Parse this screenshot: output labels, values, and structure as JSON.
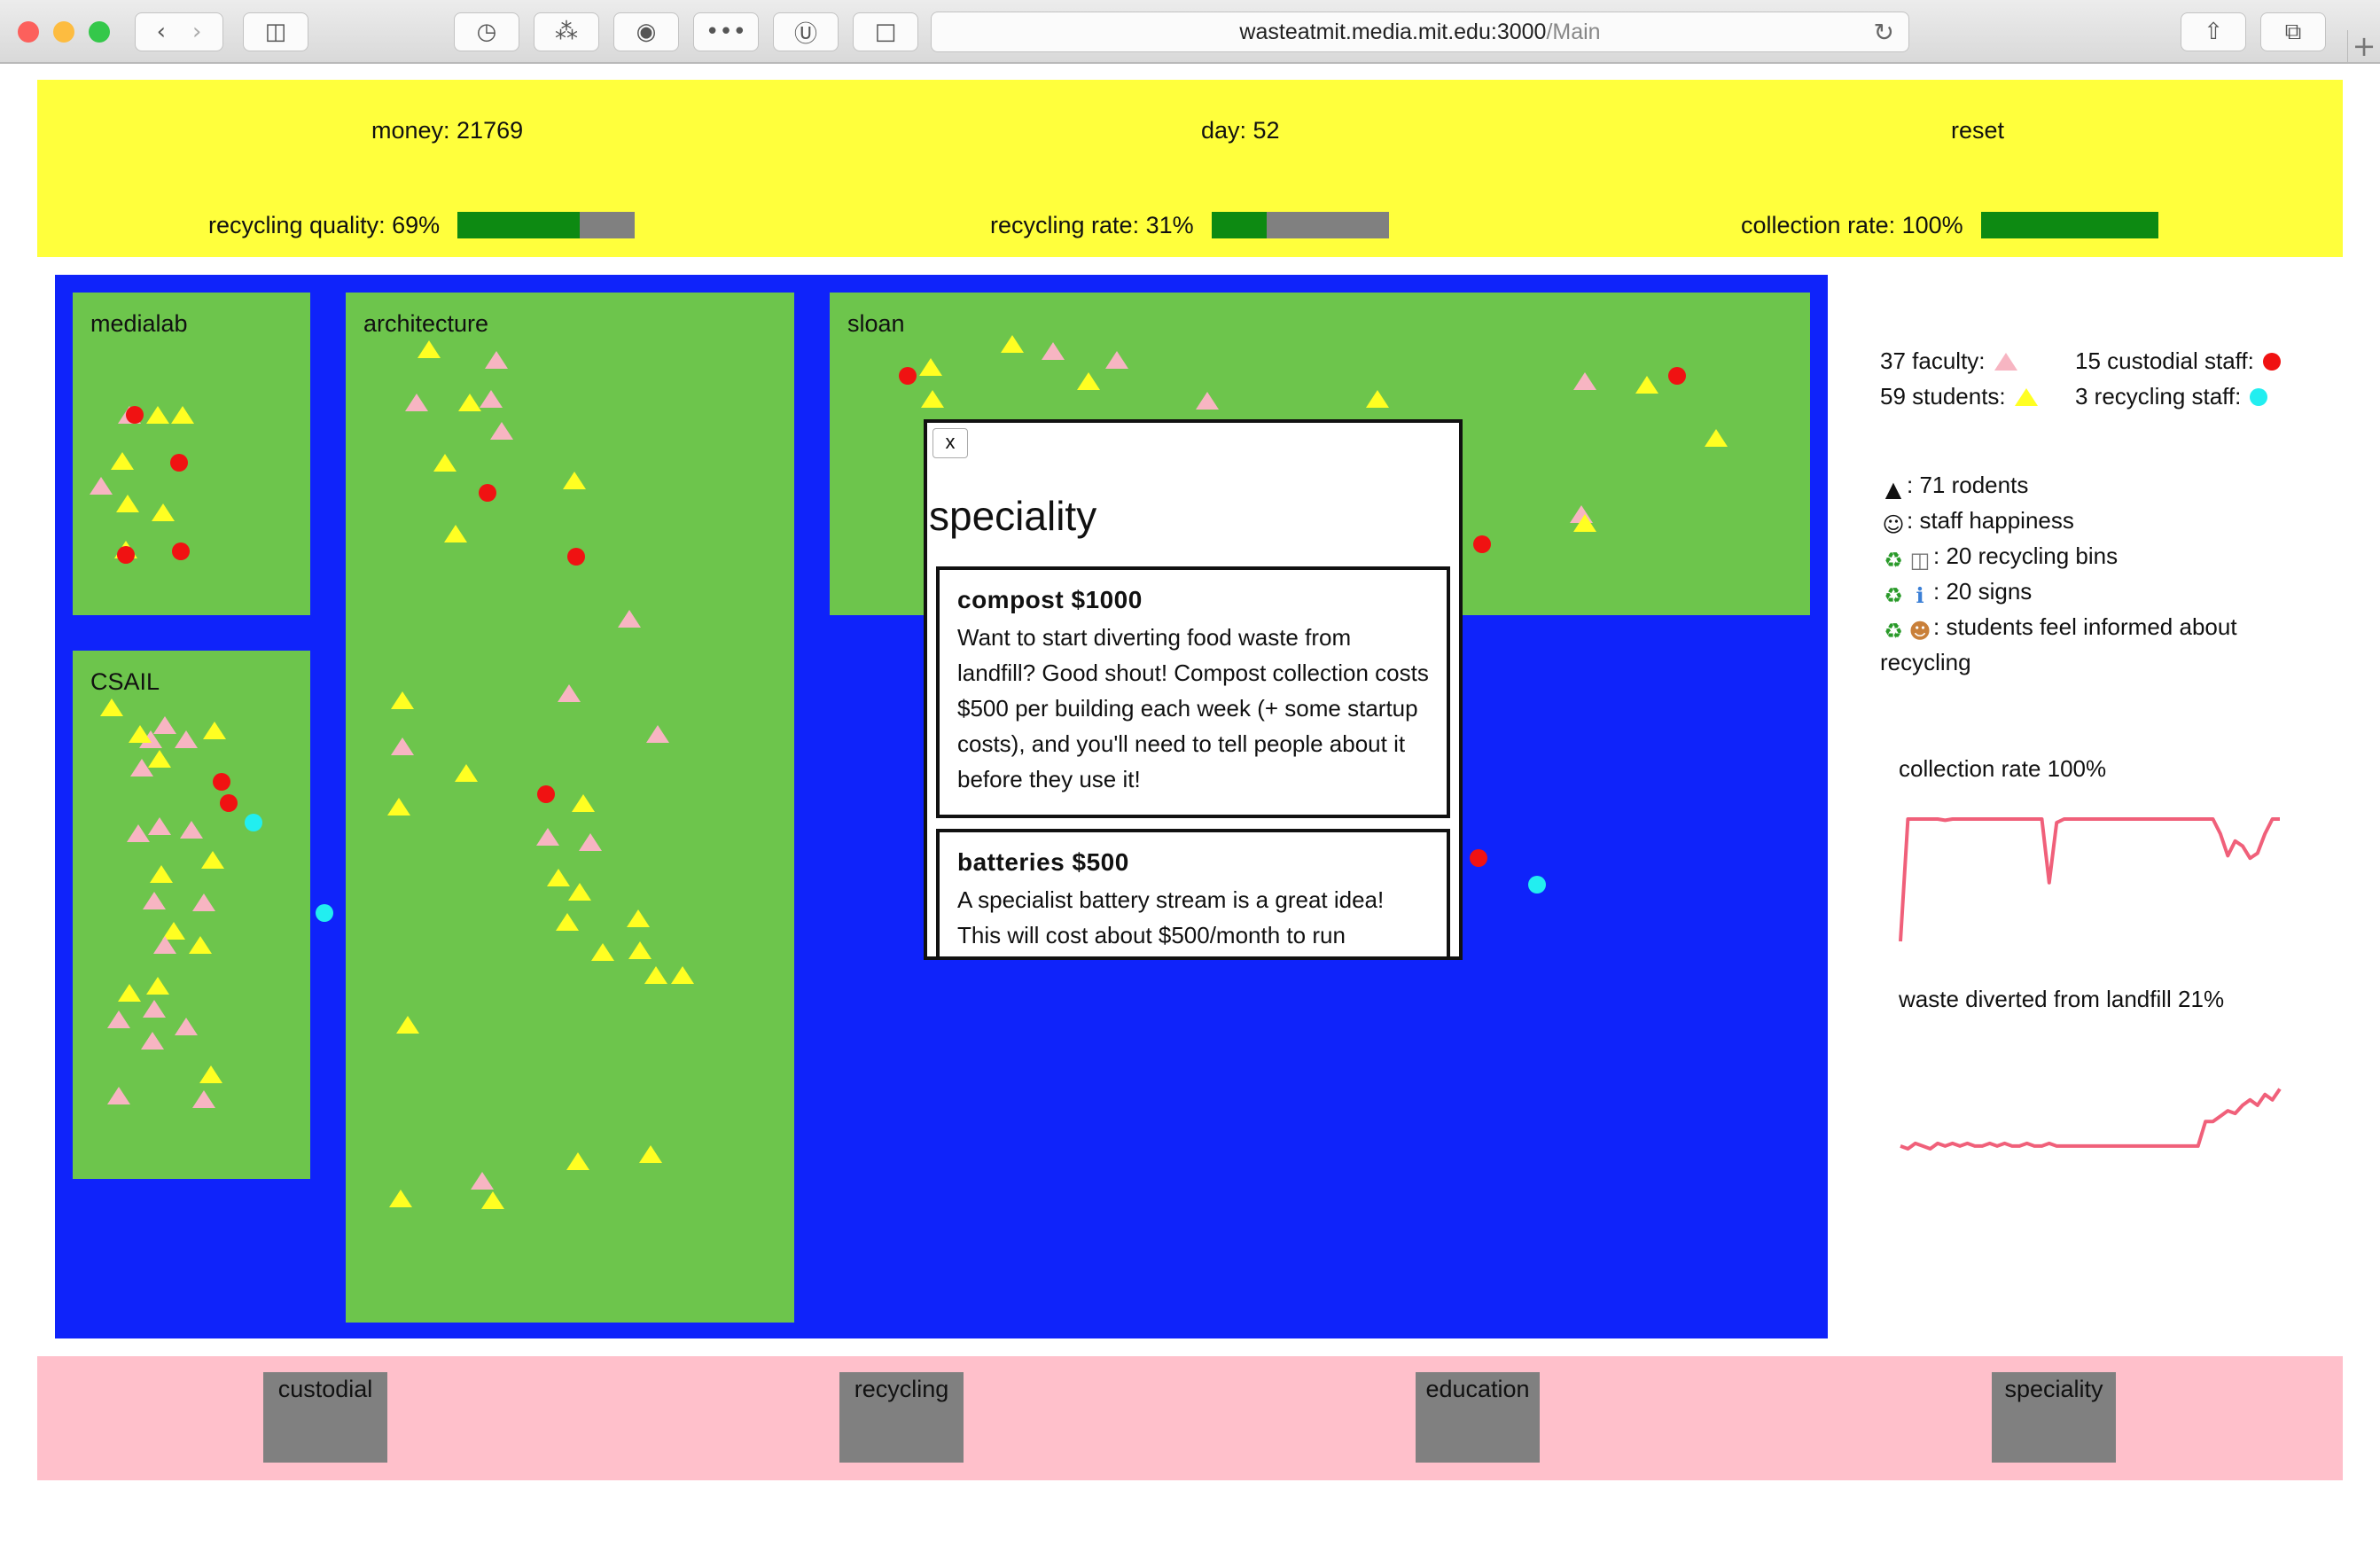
{
  "browser": {
    "url_host": "wasteatmit.media.mit.edu:3000",
    "url_path": "/Main"
  },
  "status": {
    "money_text": "money: 21769",
    "day_text": "day: 52",
    "reset_label": "reset",
    "metrics": [
      {
        "label": "recycling quality: 69%",
        "value": 69
      },
      {
        "label": "recycling rate: 31%",
        "value": 31
      },
      {
        "label": "collection rate: 100%",
        "value": 100
      }
    ]
  },
  "buildings": [
    {
      "name": "medialab"
    },
    {
      "name": "CSAIL"
    },
    {
      "name": "architecture"
    },
    {
      "name": "sloan"
    }
  ],
  "popup": {
    "close_label": "x",
    "title": "speciality",
    "items": [
      {
        "title": "compost $1000",
        "description": "Want to start diverting food waste from landfill? Good shout! Compost collection costs $500 per building each week (+ some startup costs), and you'll need to tell people about it before they use it!"
      },
      {
        "title": "batteries $500",
        "description": "A specialist battery stream is a great idea! This will cost about $500/month to run"
      }
    ]
  },
  "sidebar": {
    "faculty": "37 faculty:",
    "students": "59 students:",
    "custodial": "15 custodial staff:",
    "recycling_staff": "3 recycling staff:",
    "rodents": ": 71 rodents",
    "happiness": ": staff happiness",
    "bins": ": 20 recycling bins",
    "signs": ": 20 signs",
    "informed_line1": ": students feel informed about",
    "informed_line2": "recycling"
  },
  "charts_text": {
    "collection_label": "collection rate 100%",
    "waste_label": "waste diverted from landfill 21%"
  },
  "chart_data": [
    {
      "type": "line",
      "title": "collection rate 100%",
      "xlabel": "",
      "ylabel": "",
      "ylim": [
        0,
        100
      ],
      "x": [
        1,
        2,
        3,
        4,
        5,
        6,
        7,
        8,
        9,
        10,
        11,
        12,
        13,
        14,
        15,
        16,
        17,
        18,
        19,
        20,
        21,
        22,
        23,
        24,
        25,
        26,
        27,
        28,
        29,
        30,
        31,
        32,
        33,
        34,
        35,
        36,
        37,
        38,
        39,
        40,
        41,
        42,
        43,
        44,
        45,
        46,
        47,
        48,
        49,
        50,
        51,
        52
      ],
      "values": [
        0,
        100,
        100,
        100,
        100,
        100,
        99,
        100,
        100,
        100,
        100,
        100,
        100,
        100,
        100,
        100,
        100,
        100,
        100,
        100,
        48,
        97,
        100,
        100,
        100,
        100,
        100,
        100,
        100,
        100,
        100,
        100,
        100,
        100,
        100,
        100,
        100,
        100,
        100,
        100,
        100,
        100,
        100,
        88,
        70,
        82,
        78,
        68,
        72,
        88,
        100,
        100
      ],
      "color": "#f0607a"
    },
    {
      "type": "line",
      "title": "waste diverted from landfill 21%",
      "xlabel": "",
      "ylabel": "",
      "ylim": [
        0,
        30
      ],
      "x": [
        1,
        2,
        3,
        4,
        5,
        6,
        7,
        8,
        9,
        10,
        11,
        12,
        13,
        14,
        15,
        16,
        17,
        18,
        19,
        20,
        21,
        22,
        23,
        24,
        25,
        26,
        27,
        28,
        29,
        30,
        31,
        32,
        33,
        34,
        35,
        36,
        37,
        38,
        39,
        40,
        41,
        42,
        43,
        44,
        45,
        46,
        47,
        48,
        49,
        50,
        51,
        52
      ],
      "values": [
        1,
        0,
        2,
        1,
        0,
        2,
        1,
        2,
        1,
        2,
        1,
        1,
        2,
        1,
        2,
        1,
        1,
        2,
        1,
        1,
        2,
        1,
        1,
        1,
        1,
        1,
        1,
        1,
        1,
        1,
        1,
        1,
        1,
        1,
        1,
        1,
        1,
        1,
        1,
        1,
        1,
        10,
        10,
        12,
        14,
        13,
        16,
        18,
        16,
        20,
        18,
        22
      ],
      "color": "#f0607a"
    }
  ],
  "actions": {
    "custodial": "custodial",
    "recycling": "recycling",
    "education": "education",
    "speciality": "speciality"
  },
  "colors": {
    "status_bg": "#ffff3c",
    "map_bg": "#0f23fa",
    "building": "#6dc54c",
    "student": "#ffff22",
    "faculty": "#f7b5c2",
    "custodial_staff": "#f01212",
    "recycling_staff": "#22eef0",
    "bar_fill": "#0d8a12",
    "bar_empty": "#808080",
    "actions_bg": "#ffc0cb"
  }
}
